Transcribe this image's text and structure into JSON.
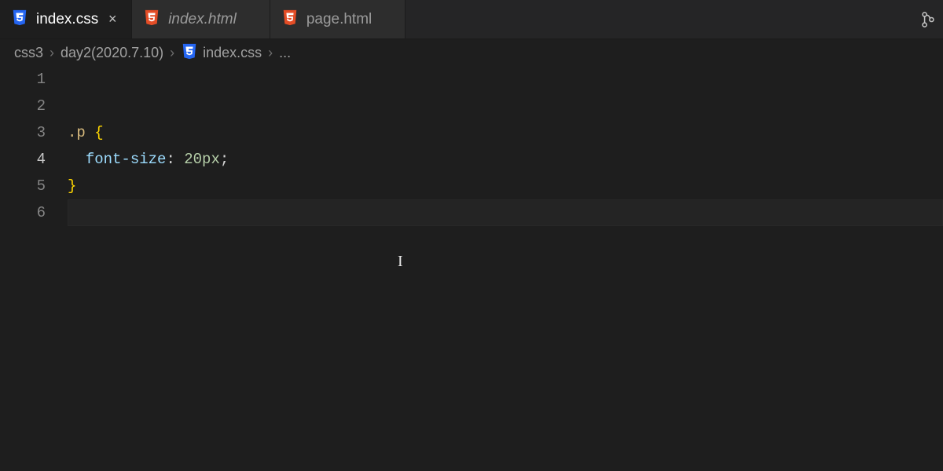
{
  "tabs": [
    {
      "label": "index.css",
      "icon": "css",
      "active": true,
      "italic": false
    },
    {
      "label": "index.html",
      "icon": "html",
      "active": false,
      "italic": true
    },
    {
      "label": "page.html",
      "icon": "html",
      "active": false,
      "italic": false
    }
  ],
  "breadcrumb": {
    "segments": [
      "css3",
      "day2(2020.7.10)",
      "index.css"
    ],
    "file_icon": "css",
    "tail": "..."
  },
  "editor": {
    "current_line": 4,
    "lines": [
      {
        "n": 1,
        "tokens": [
          {
            "t": ".p ",
            "c": "tok-selector"
          },
          {
            "t": "{",
            "c": "tok-brace"
          }
        ]
      },
      {
        "n": 2,
        "tokens": [
          {
            "t": "  ",
            "c": ""
          },
          {
            "t": "font-size",
            "c": "tok-prop"
          },
          {
            "t": ": ",
            "c": "tok-punct"
          },
          {
            "t": "20px",
            "c": "tok-value"
          },
          {
            "t": ";",
            "c": "tok-punct"
          }
        ]
      },
      {
        "n": 3,
        "tokens": [
          {
            "t": "}",
            "c": "tok-brace"
          }
        ]
      },
      {
        "n": 4,
        "tokens": [
          {
            "t": "",
            "c": ""
          }
        ]
      },
      {
        "n": 5,
        "tokens": [
          {
            "t": "",
            "c": ""
          }
        ]
      },
      {
        "n": 6,
        "tokens": [
          {
            "t": "",
            "c": ""
          }
        ]
      }
    ]
  },
  "icons": {
    "close_glyph": "×",
    "chevron": "›"
  }
}
